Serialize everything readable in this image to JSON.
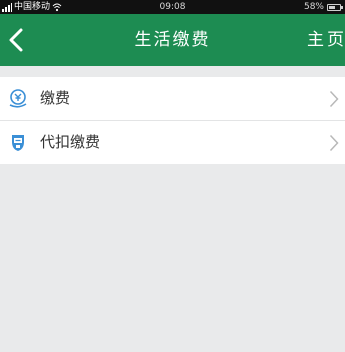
{
  "status_bar": {
    "carrier": "中国移动",
    "time": "09:08",
    "battery": "58%",
    "battery_level": 0.58
  },
  "header": {
    "title": "生活缴费",
    "home_label": "主页"
  },
  "menu": {
    "items": [
      {
        "label": "缴费",
        "icon": "payment-icon"
      },
      {
        "label": "代扣缴费",
        "icon": "auto-debit-icon"
      }
    ]
  },
  "colors": {
    "header_bg": "#1d8c52",
    "icon_blue": "#3a8fd6",
    "page_bg": "#e9eaeb"
  }
}
